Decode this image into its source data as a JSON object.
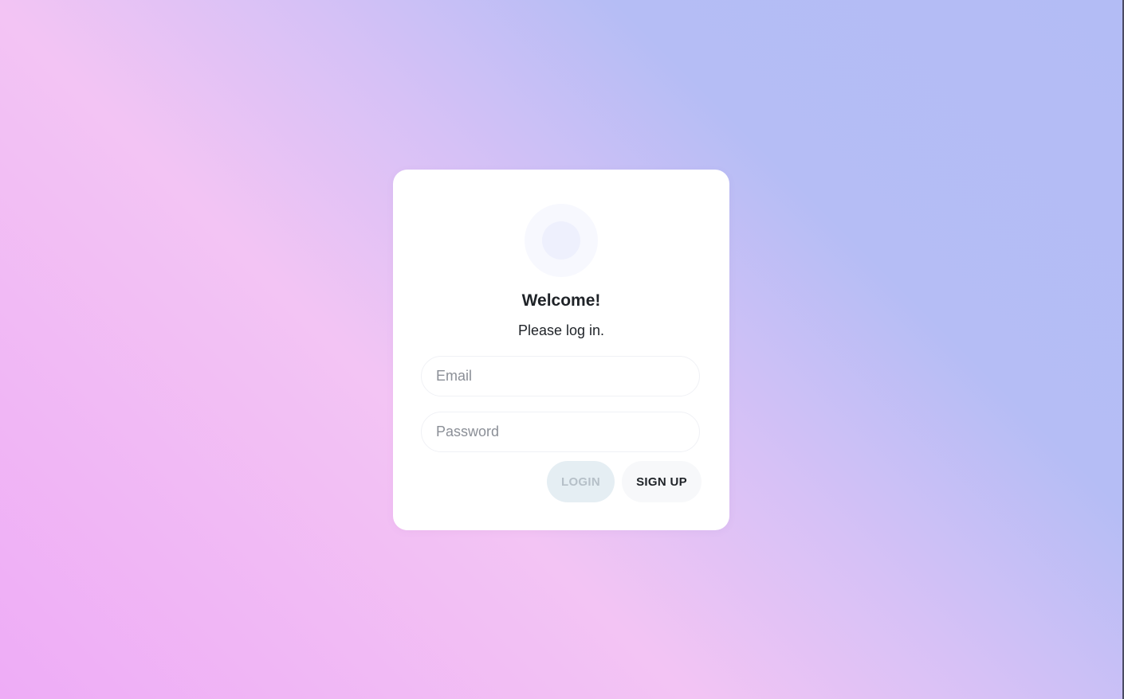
{
  "login": {
    "title": "Welcome!",
    "subtitle": "Please log in.",
    "email": {
      "placeholder": "Email",
      "value": ""
    },
    "password": {
      "placeholder": "Password",
      "value": ""
    },
    "login_label": "LOGIN",
    "signup_label": "SIGN UP"
  },
  "colors": {
    "login_button_bg": "#e5eef3",
    "login_button_text": "#b6c0c8",
    "signup_button_bg": "#f7f8fa",
    "text": "#1f2328"
  },
  "icons": {
    "avatar": "avatar-placeholder-circle"
  }
}
